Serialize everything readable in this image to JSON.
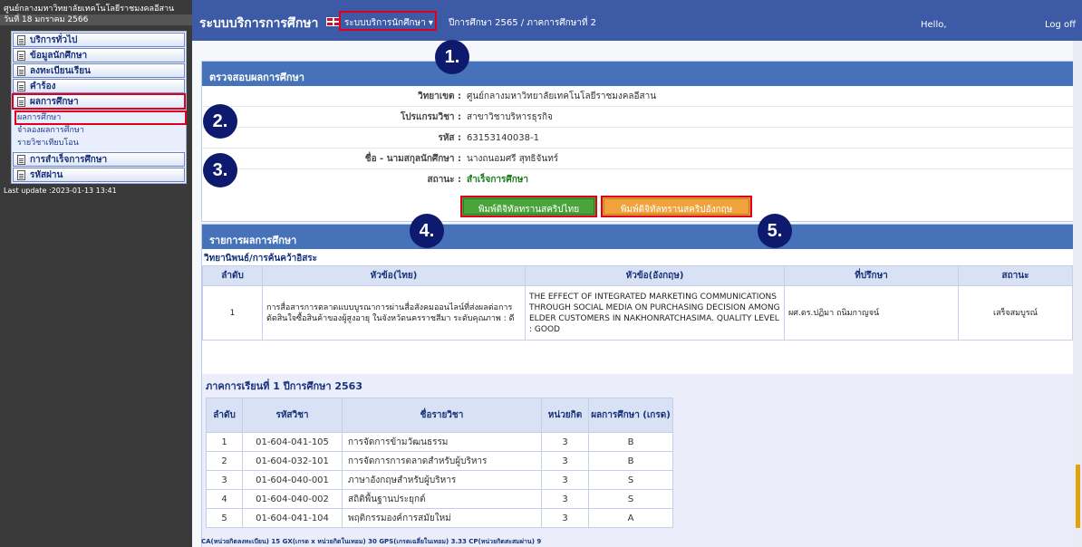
{
  "sidebar": {
    "university": "ศูนย์กลางมหาวิทยาลัยเทคโนโลยีราชมงคลอีสาน",
    "date": "วันที่ 18 มกราคม 2566",
    "menu": [
      {
        "label": "บริการทั่วไป"
      },
      {
        "label": "ข้อมูลนักศึกษา"
      },
      {
        "label": "ลงทะเบียนเรียน"
      },
      {
        "label": "คำร้อง"
      },
      {
        "label": "ผลการศึกษา"
      }
    ],
    "submenu": [
      {
        "label": "ผลการศึกษา"
      },
      {
        "label": "จำลองผลการศึกษา"
      },
      {
        "label": "รายวิชาเทียบโอน"
      }
    ],
    "menu_after": [
      {
        "label": "การสำเร็จการศึกษา"
      },
      {
        "label": "รหัสผ่าน"
      }
    ],
    "last_update": "Last update :2023-01-13 13:41"
  },
  "topbar": {
    "title": "ระบบบริการการศึกษา",
    "system_menu": "ระบบบริการนักศึกษา ▾",
    "year": "ปีการศึกษา 2565 / ภาคการศึกษาที่ 2",
    "hello": "Hello,",
    "logoff": "Log off"
  },
  "check": {
    "header": "ตรวจสอบผลการศึกษา",
    "rows": [
      {
        "label": "วิทยาเขต :",
        "value": "ศูนย์กลางมหาวิทยาลัยเทคโนโลยีราชมงคลอีสาน"
      },
      {
        "label": "โปรแกรมวิชา :",
        "value": "สาขาวิชาบริหารธุรกิจ"
      },
      {
        "label": "รหัส :",
        "value": "63153140038-1"
      },
      {
        "label": "ชื่อ - นามสกุลนักศึกษา :",
        "value": "นางถนอมศรี สุทธิจันทร์"
      }
    ],
    "status_label": "สถานะ :",
    "status_value": "สำเร็จการศึกษา",
    "btn_thai": "พิมพ์ดิจิทัลทรานสคริปไทย",
    "btn_eng": "พิมพ์ดิจิทัลทรานสคริปอังกฤษ"
  },
  "results": {
    "header": "รายการผลการศึกษา",
    "thesis_title": "วิทยานิพนธ์/การค้นคว้าอิสระ",
    "thesis_cols": [
      "ลำดับ",
      "หัวข้อ(ไทย)",
      "หัวข้อ(อังกฤษ)",
      "ที่ปรึกษา",
      "สถานะ"
    ],
    "thesis_row": {
      "no": "1",
      "thai": "การสื่อสารการตลาดแบบบูรณาการผ่านสื่อสังคมออนไลน์ที่ส่งผลต่อการตัดสินใจซื้อสินค้าของผู้สูงอายุ ในจังหวัดนครราชสีมา ระดับคุณภาพ : ดี",
      "eng": "THE EFFECT OF INTEGRATED MARKETING COMMUNICATIONS THROUGH SOCIAL MEDIA ON PURCHASING DECISION AMONG ELDER CUSTOMERS IN NAKHONRATCHASIMA. QUALITY LEVEL : GOOD",
      "advisor": "ผศ.ดร.ปฏิมา ถนิมกาญจน์",
      "status": "เสร็จสมบูรณ์"
    },
    "semester_title": "ภาคการเรียนที่ 1   ปีการศึกษา 2563",
    "course_cols": [
      "ลำดับ",
      "รหัสวิชา",
      "ชื่อรายวิชา",
      "หน่วยกิต",
      "ผลการศึกษา (เกรด)"
    ],
    "courses": [
      {
        "no": "1",
        "code": "01-604-041-105",
        "name": "การจัดการข้ามวัฒนธรรม",
        "credit": "3",
        "grade": "B"
      },
      {
        "no": "2",
        "code": "01-604-032-101",
        "name": "การจัดการการตลาดสำหรับผู้บริหาร",
        "credit": "3",
        "grade": "B"
      },
      {
        "no": "3",
        "code": "01-604-040-001",
        "name": "ภาษาอังกฤษสำหรับผู้บริหาร",
        "credit": "3",
        "grade": "S"
      },
      {
        "no": "4",
        "code": "01-604-040-002",
        "name": "สถิติพื้นฐานประยุกต์",
        "credit": "3",
        "grade": "S"
      },
      {
        "no": "5",
        "code": "01-604-041-104",
        "name": "พฤติกรรมองค์การสมัยใหม่",
        "credit": "3",
        "grade": "A"
      }
    ],
    "summary": "CA(หน่วยกิตลงทะเบียน)    15 GX(เกรด x หน่วยกิตในเทอม) 30 GPS(เกรดเฉลี่ยในเทอม)    3.33 CP(หน่วยกิตสะสมผ่าน)    9"
  },
  "annotations": [
    "1.",
    "2.",
    "3.",
    "4.",
    "5."
  ]
}
